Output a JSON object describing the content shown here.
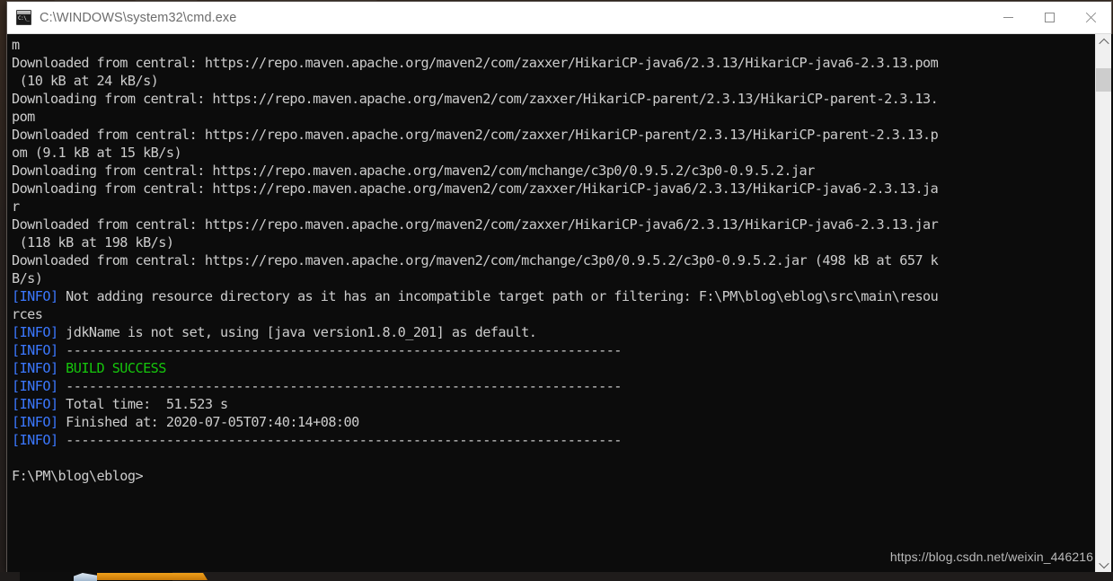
{
  "window": {
    "title": "C:\\WINDOWS\\system32\\cmd.exe",
    "icon": "cmd-console-icon",
    "minimize_label": "Minimize",
    "maximize_label": "Maximize",
    "close_label": "Close"
  },
  "scrollbar": {
    "up_label": "Scroll up",
    "down_label": "Scroll down",
    "thumb_label": "Scroll thumb"
  },
  "console": {
    "prompt": "F:\\PM\\blog\\eblog>",
    "colors": {
      "background": "#0c0c0c",
      "foreground": "#cccccc",
      "info_blue": "#3b78ff",
      "success_green": "#16c60c"
    },
    "lines": [
      {
        "segments": [
          {
            "text": "m",
            "color": "default"
          }
        ]
      },
      {
        "segments": [
          {
            "text": "Downloaded from central: https://repo.maven.apache.org/maven2/com/zaxxer/HikariCP-java6/2.3.13/HikariCP-java6-2.3.13.pom",
            "color": "default"
          }
        ]
      },
      {
        "segments": [
          {
            "text": " (10 kB at 24 kB/s)",
            "color": "default"
          }
        ]
      },
      {
        "segments": [
          {
            "text": "Downloading from central: https://repo.maven.apache.org/maven2/com/zaxxer/HikariCP-parent/2.3.13/HikariCP-parent-2.3.13.",
            "color": "default"
          }
        ]
      },
      {
        "segments": [
          {
            "text": "pom",
            "color": "default"
          }
        ]
      },
      {
        "segments": [
          {
            "text": "Downloaded from central: https://repo.maven.apache.org/maven2/com/zaxxer/HikariCP-parent/2.3.13/HikariCP-parent-2.3.13.p",
            "color": "default"
          }
        ]
      },
      {
        "segments": [
          {
            "text": "om (9.1 kB at 15 kB/s)",
            "color": "default"
          }
        ]
      },
      {
        "segments": [
          {
            "text": "Downloading from central: https://repo.maven.apache.org/maven2/com/mchange/c3p0/0.9.5.2/c3p0-0.9.5.2.jar",
            "color": "default"
          }
        ]
      },
      {
        "segments": [
          {
            "text": "Downloading from central: https://repo.maven.apache.org/maven2/com/zaxxer/HikariCP-java6/2.3.13/HikariCP-java6-2.3.13.ja",
            "color": "default"
          }
        ]
      },
      {
        "segments": [
          {
            "text": "r",
            "color": "default"
          }
        ]
      },
      {
        "segments": [
          {
            "text": "Downloaded from central: https://repo.maven.apache.org/maven2/com/zaxxer/HikariCP-java6/2.3.13/HikariCP-java6-2.3.13.jar",
            "color": "default"
          }
        ]
      },
      {
        "segments": [
          {
            "text": " (118 kB at 198 kB/s)",
            "color": "default"
          }
        ]
      },
      {
        "segments": [
          {
            "text": "Downloaded from central: https://repo.maven.apache.org/maven2/com/mchange/c3p0/0.9.5.2/c3p0-0.9.5.2.jar (498 kB at 657 k",
            "color": "default"
          }
        ]
      },
      {
        "segments": [
          {
            "text": "B/s)",
            "color": "default"
          }
        ]
      },
      {
        "segments": [
          {
            "text": "[INFO]",
            "color": "info"
          },
          {
            "text": " Not adding resource directory as it has an incompatible target path or filtering: F:\\PM\\blog\\eblog\\src\\main\\resou",
            "color": "default"
          }
        ]
      },
      {
        "segments": [
          {
            "text": "rces",
            "color": "default"
          }
        ]
      },
      {
        "segments": [
          {
            "text": "[INFO]",
            "color": "info"
          },
          {
            "text": " jdkName is not set, using [java version1.8.0_201] as default.",
            "color": "default"
          }
        ]
      },
      {
        "segments": [
          {
            "text": "[INFO]",
            "color": "info"
          },
          {
            "text": " ------------------------------------------------------------------------",
            "color": "default"
          }
        ]
      },
      {
        "segments": [
          {
            "text": "[INFO]",
            "color": "info"
          },
          {
            "text": " ",
            "color": "default"
          },
          {
            "text": "BUILD SUCCESS",
            "color": "green"
          }
        ]
      },
      {
        "segments": [
          {
            "text": "[INFO]",
            "color": "info"
          },
          {
            "text": " ------------------------------------------------------------------------",
            "color": "default"
          }
        ]
      },
      {
        "segments": [
          {
            "text": "[INFO]",
            "color": "info"
          },
          {
            "text": " Total time:  51.523 s",
            "color": "default"
          }
        ]
      },
      {
        "segments": [
          {
            "text": "[INFO]",
            "color": "info"
          },
          {
            "text": " Finished at: 2020-07-05T07:40:14+08:00",
            "color": "default"
          }
        ]
      },
      {
        "segments": [
          {
            "text": "[INFO]",
            "color": "info"
          },
          {
            "text": " ------------------------------------------------------------------------",
            "color": "default"
          }
        ]
      },
      {
        "segments": [
          {
            "text": "",
            "color": "default"
          }
        ]
      },
      {
        "segments": [
          {
            "text": "F:\\PM\\blog\\eblog>",
            "color": "default"
          }
        ]
      }
    ]
  },
  "watermark": {
    "text": "https://blog.csdn.net/weixin_446216"
  }
}
